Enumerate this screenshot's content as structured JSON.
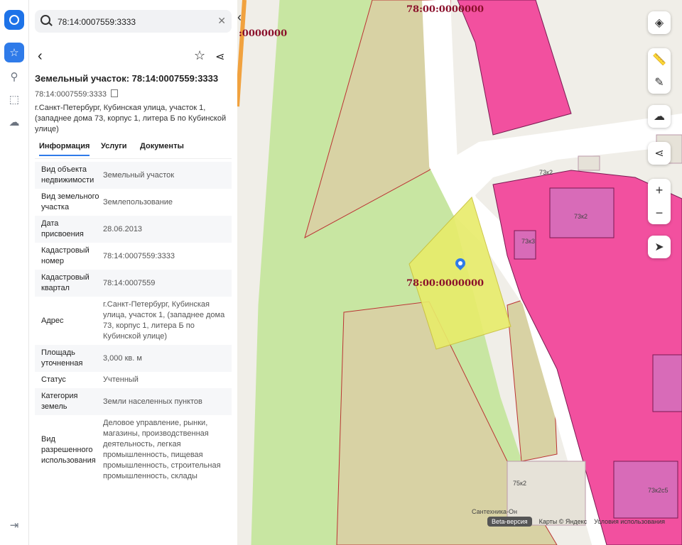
{
  "search": {
    "value": "78:14:0007559:3333"
  },
  "panel": {
    "title": "Земельный участок: 78:14:0007559:3333",
    "cad_number": "78:14:0007559:3333",
    "address": "г.Санкт-Петербург, Кубинская улица, участок 1, (западнее дома 73, корпус 1, литера Б по Кубинской улице)",
    "tabs": [
      "Информация",
      "Услуги",
      "Документы"
    ],
    "rows": [
      {
        "k": "Вид объекта недвижимости",
        "v": "Земельный участок"
      },
      {
        "k": "Вид земельного участка",
        "v": "Землепользование"
      },
      {
        "k": "Дата присвоения",
        "v": "28.06.2013"
      },
      {
        "k": "Кадастровый номер",
        "v": "78:14:0007559:3333"
      },
      {
        "k": "Кадастровый квартал",
        "v": "78:14:0007559"
      },
      {
        "k": "Адрес",
        "v": "г.Санкт-Петербург, Кубинская улица, участок 1, (западнее дома 73, корпус 1, литера Б по Кубинской улице)"
      },
      {
        "k": "Площадь уточненная",
        "v": "3,000 кв. м"
      },
      {
        "k": "Статус",
        "v": "Учтенный"
      },
      {
        "k": "Категория земель",
        "v": "Земли населенных пунктов"
      },
      {
        "k": "Вид разрешенного использования",
        "v": "Деловое управление, рынки, магазины, производственная деятельность, легкая промышленность, пищевая промышленность, строительная промышленность, склады"
      }
    ]
  },
  "map": {
    "labels": {
      "top_center": "78:00:0000000",
      "top_left": ":0000000",
      "parcel": "78:00:0000000",
      "b73k2_small": "73к2",
      "b73k2": "73к2",
      "b73k3": "73к3",
      "b75k2": "75к2",
      "b73k2s5": "73к2с5",
      "poi": "Сантехника-Он"
    },
    "footer": {
      "beta": "Beta-версия",
      "yandex": "Карты © Яндекс",
      "terms": "Условия использования"
    }
  },
  "colors": {
    "accent": "#2f7be9",
    "parcel_yellow": "#e8ec6a",
    "zone_magenta": "#f2509f",
    "zone_green": "#c8e6a2",
    "zone_olive": "#d8d2a4",
    "border": "#8a0f2a"
  }
}
